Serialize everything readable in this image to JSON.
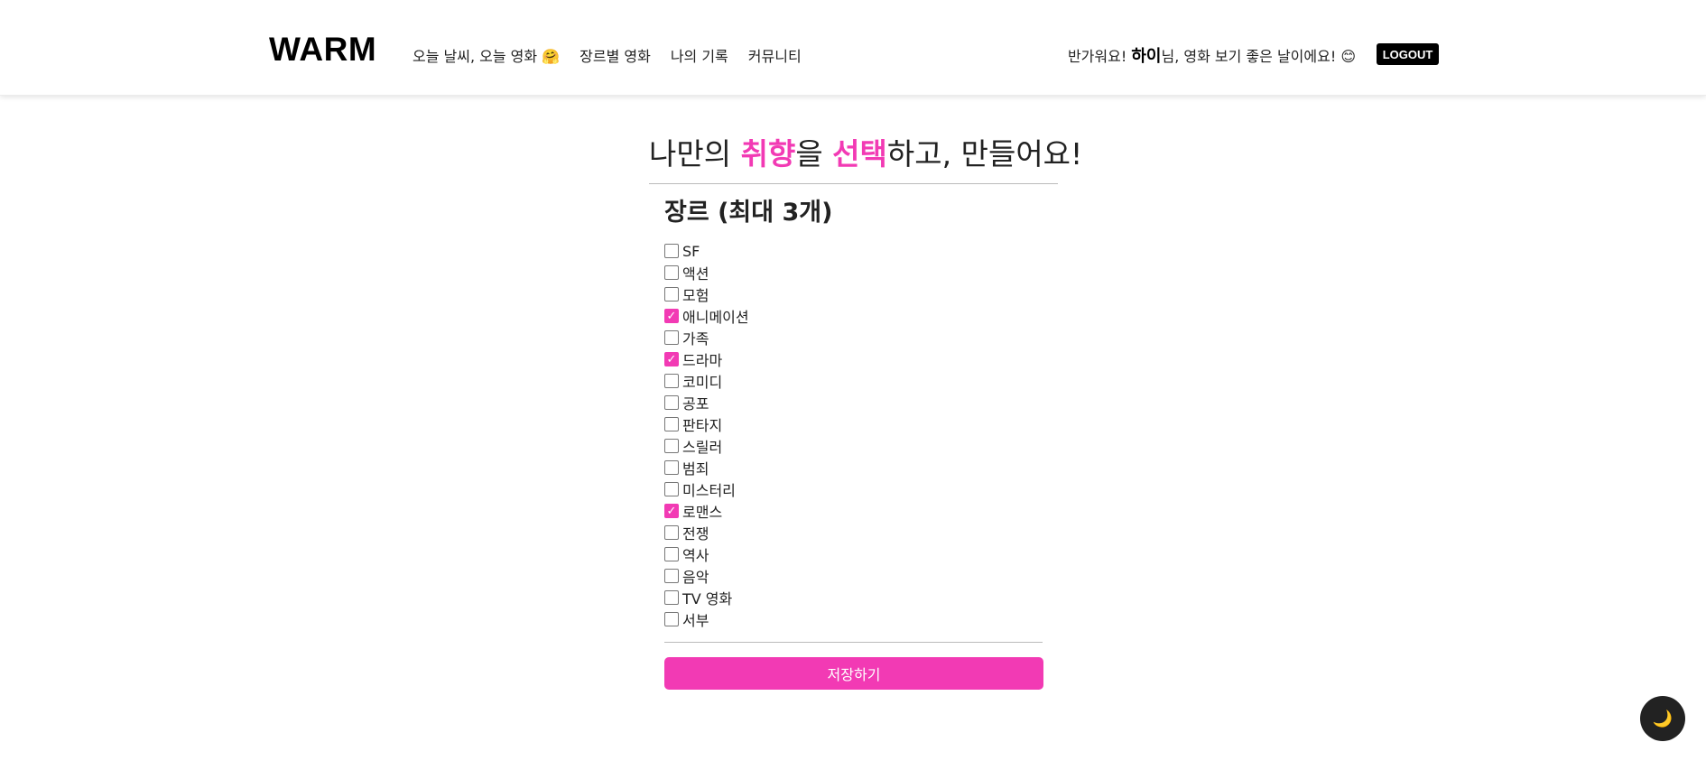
{
  "header": {
    "logo": "WARM",
    "nav": [
      "오늘 날씨, 오늘 영화 🤗",
      "장르별 영화",
      "나의 기록",
      "커뮤니티"
    ],
    "greeting_prefix": "반가워요! ",
    "username": "하이",
    "greeting_suffix": "님, 영화 보기 좋은 날이에요! 😊",
    "logout_label": "LOGOUT"
  },
  "main": {
    "title_part1": "나만의 ",
    "title_accent1": "취향",
    "title_part2": "을 ",
    "title_accent2": "선택",
    "title_part3": "하고, 만들어요!",
    "section_title": "장르 (최대 3개)",
    "genres": [
      {
        "label": "SF",
        "checked": false
      },
      {
        "label": "액션",
        "checked": false
      },
      {
        "label": "모험",
        "checked": false
      },
      {
        "label": "애니메이션",
        "checked": true
      },
      {
        "label": "가족",
        "checked": false
      },
      {
        "label": "드라마",
        "checked": true
      },
      {
        "label": "코미디",
        "checked": false
      },
      {
        "label": "공포",
        "checked": false
      },
      {
        "label": "판타지",
        "checked": false
      },
      {
        "label": "스릴러",
        "checked": false
      },
      {
        "label": "범죄",
        "checked": false
      },
      {
        "label": "미스터리",
        "checked": false
      },
      {
        "label": "로맨스",
        "checked": true
      },
      {
        "label": "전쟁",
        "checked": false
      },
      {
        "label": "역사",
        "checked": false
      },
      {
        "label": "음악",
        "checked": false
      },
      {
        "label": "TV 영화",
        "checked": false
      },
      {
        "label": "서부",
        "checked": false
      }
    ],
    "save_label": "저장하기"
  },
  "dark_toggle_icon": "🌙",
  "colors": {
    "accent": "#f23ab4",
    "header_bg": "#ffffff",
    "logout_bg": "#000000",
    "toggle_bg": "#222222"
  },
  "icons": {
    "check": "checkmark-icon",
    "dark_toggle": "moon-icon"
  }
}
